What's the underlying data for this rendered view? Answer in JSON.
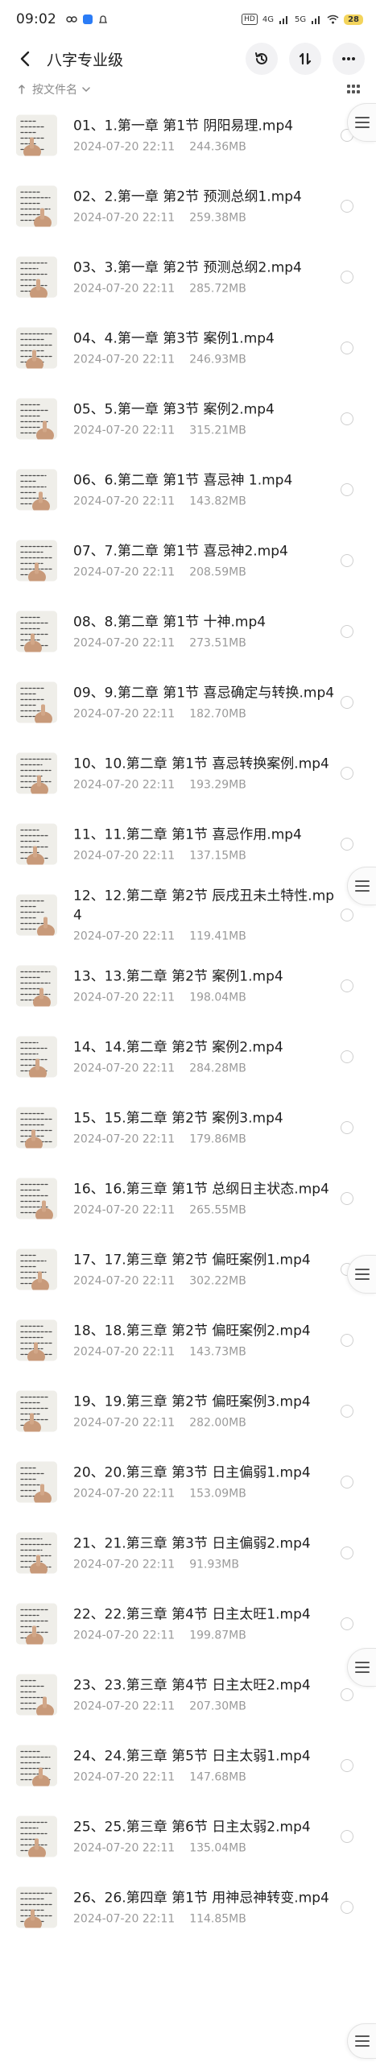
{
  "status_bar": {
    "time": "09:02",
    "network": "4G",
    "network2": "5G",
    "battery": "28"
  },
  "header": {
    "title": "八字专业级",
    "back_icon": "chevron-left-icon",
    "actions": [
      "history-icon",
      "sort-arrows-icon",
      "more-icon"
    ]
  },
  "sort": {
    "label": "按文件名",
    "view_icon": "grid-view-icon"
  },
  "files": [
    {
      "name": "01、1.第一章 第1节 阴阳易理.mp4",
      "date": "2024-07-20",
      "time": "22:11",
      "size": "244.36MB"
    },
    {
      "name": "02、2.第一章 第2节 预测总纲1.mp4",
      "date": "2024-07-20",
      "time": "22:11",
      "size": "259.38MB"
    },
    {
      "name": "03、3.第一章 第2节 预测总纲2.mp4",
      "date": "2024-07-20",
      "time": "22:11",
      "size": "285.72MB"
    },
    {
      "name": "04、4.第一章 第3节 案例1.mp4",
      "date": "2024-07-20",
      "time": "22:11",
      "size": "246.93MB"
    },
    {
      "name": "05、5.第一章 第3节 案例2.mp4",
      "date": "2024-07-20",
      "time": "22:11",
      "size": "315.21MB"
    },
    {
      "name": "06、6.第二章 第1节 喜忌神 1.mp4",
      "date": "2024-07-20",
      "time": "22:11",
      "size": "143.82MB"
    },
    {
      "name": "07、7.第二章 第1节 喜忌神2.mp4",
      "date": "2024-07-20",
      "time": "22:11",
      "size": "208.59MB"
    },
    {
      "name": "08、8.第二章 第1节 十神.mp4",
      "date": "2024-07-20",
      "time": "22:11",
      "size": "273.51MB"
    },
    {
      "name": "09、9.第二章 第1节 喜忌确定与转换.mp4",
      "date": "2024-07-20",
      "time": "22:11",
      "size": "182.70MB"
    },
    {
      "name": "10、10.第二章 第1节 喜忌转换案例.mp4",
      "date": "2024-07-20",
      "time": "22:11",
      "size": "193.29MB"
    },
    {
      "name": "11、11.第二章 第1节 喜忌作用.mp4",
      "date": "2024-07-20",
      "time": "22:11",
      "size": "137.15MB"
    },
    {
      "name": "12、12.第二章 第2节 辰戌丑未土特性.mp4",
      "date": "2024-07-20",
      "time": "22:11",
      "size": "119.41MB"
    },
    {
      "name": "13、13.第二章 第2节 案例1.mp4",
      "date": "2024-07-20",
      "time": "22:11",
      "size": "198.04MB"
    },
    {
      "name": "14、14.第二章 第2节 案例2.mp4",
      "date": "2024-07-20",
      "time": "22:11",
      "size": "284.28MB"
    },
    {
      "name": "15、15.第二章 第2节 案例3.mp4",
      "date": "2024-07-20",
      "time": "22:11",
      "size": "179.86MB"
    },
    {
      "name": "16、16.第三章 第1节 总纲日主状态.mp4",
      "date": "2024-07-20",
      "time": "22:11",
      "size": "265.55MB"
    },
    {
      "name": "17、17.第三章 第2节 偏旺案例1.mp4",
      "date": "2024-07-20",
      "time": "22:11",
      "size": "302.22MB"
    },
    {
      "name": "18、18.第三章 第2节 偏旺案例2.mp4",
      "date": "2024-07-20",
      "time": "22:11",
      "size": "143.73MB"
    },
    {
      "name": "19、19.第三章 第2节 偏旺案例3.mp4",
      "date": "2024-07-20",
      "time": "22:11",
      "size": "282.00MB"
    },
    {
      "name": "20、20.第三章 第3节 日主偏弱1.mp4",
      "date": "2024-07-20",
      "time": "22:11",
      "size": "153.09MB"
    },
    {
      "name": "21、21.第三章 第3节 日主偏弱2.mp4",
      "date": "2024-07-20",
      "time": "22:11",
      "size": "91.93MB"
    },
    {
      "name": "22、22.第三章 第4节 日主太旺1.mp4",
      "date": "2024-07-20",
      "time": "22:11",
      "size": "199.87MB"
    },
    {
      "name": "23、23.第三章 第4节 日主太旺2.mp4",
      "date": "2024-07-20",
      "time": "22:11",
      "size": "207.30MB"
    },
    {
      "name": "24、24.第三章 第5节 日主太弱1.mp4",
      "date": "2024-07-20",
      "time": "22:11",
      "size": "147.68MB"
    },
    {
      "name": "25、25.第三章 第6节 日主太弱2.mp4",
      "date": "2024-07-20",
      "time": "22:11",
      "size": "135.04MB"
    },
    {
      "name": "26、26.第四章 第1节 用神忌神转变.mp4",
      "date": "2024-07-20",
      "time": "22:11",
      "size": "114.85MB"
    }
  ]
}
